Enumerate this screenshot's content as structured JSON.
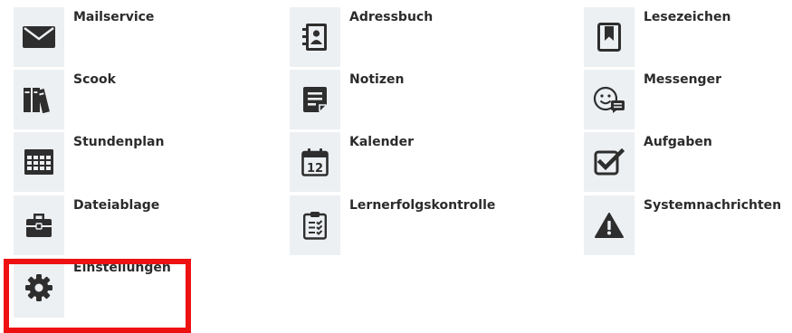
{
  "apps": [
    {
      "label": "Mailservice",
      "icon": "envelope-icon"
    },
    {
      "label": "Adressbuch",
      "icon": "address-book-icon"
    },
    {
      "label": "Lesezeichen",
      "icon": "bookmark-icon"
    },
    {
      "label": "Scook",
      "icon": "books-icon"
    },
    {
      "label": "Notizen",
      "icon": "note-icon"
    },
    {
      "label": "Messenger",
      "icon": "chat-smiley-icon"
    },
    {
      "label": "Stundenplan",
      "icon": "timetable-grid-icon"
    },
    {
      "label": "Kalender",
      "icon": "calendar-icon"
    },
    {
      "label": "Aufgaben",
      "icon": "checkbox-icon"
    },
    {
      "label": "Dateiablage",
      "icon": "briefcase-icon"
    },
    {
      "label": "Lernerfolgskontrolle",
      "icon": "checklist-clipboard-icon"
    },
    {
      "label": "Systemnachrichten",
      "icon": "warning-icon"
    },
    {
      "label": "Einstellungen",
      "icon": "gear-icon"
    }
  ],
  "calendar_icon_day": "12",
  "highlight": {
    "target": "Einstellungen",
    "color": "#ee1111"
  },
  "colors": {
    "icon": "#2e2e2e",
    "tile_background": "#edf0f3",
    "label": "#2b2b2b"
  }
}
